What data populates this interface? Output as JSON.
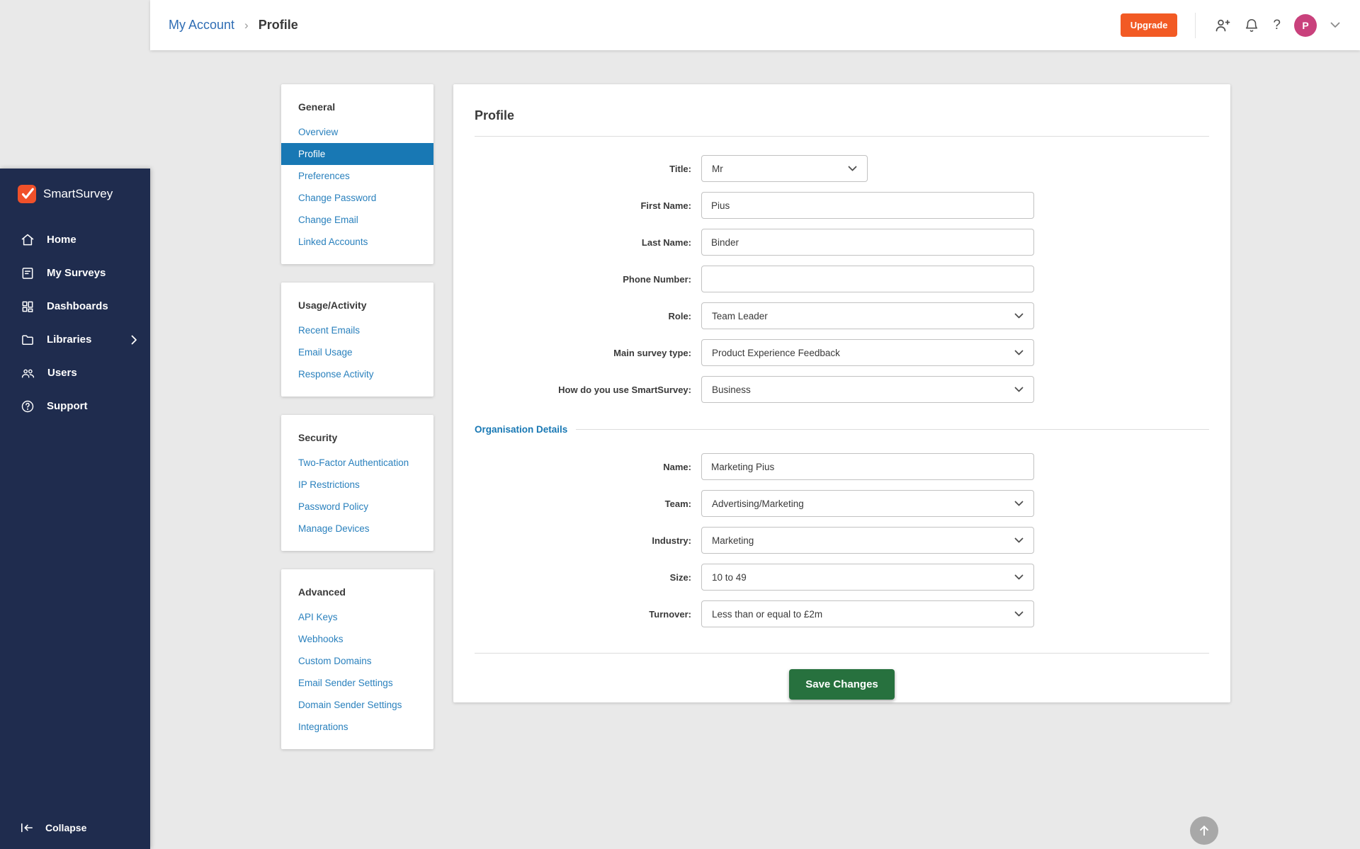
{
  "header": {
    "breadcrumb": {
      "parent": "My Account",
      "separator": "›",
      "current": "Profile"
    },
    "upgrade_label": "Upgrade",
    "help_glyph": "?",
    "avatar_initial": "P"
  },
  "sidebar": {
    "brand": "SmartSurvey",
    "items": [
      {
        "label": "Home",
        "icon": "home-icon"
      },
      {
        "label": "My Surveys",
        "icon": "surveys-icon"
      },
      {
        "label": "Dashboards",
        "icon": "dashboards-icon"
      },
      {
        "label": "Libraries",
        "icon": "folder-icon",
        "has_submenu": true
      },
      {
        "label": "Users",
        "icon": "users-icon"
      },
      {
        "label": "Support",
        "icon": "support-icon"
      }
    ],
    "collapse_label": "Collapse"
  },
  "settings_nav": {
    "sections": [
      {
        "title": "General",
        "links": [
          "Overview",
          "Profile",
          "Preferences",
          "Change Password",
          "Change Email",
          "Linked Accounts"
        ],
        "active": "Profile"
      },
      {
        "title": "Usage/Activity",
        "links": [
          "Recent Emails",
          "Email Usage",
          "Response Activity"
        ]
      },
      {
        "title": "Security",
        "links": [
          "Two-Factor Authentication",
          "IP Restrictions",
          "Password Policy",
          "Manage Devices"
        ]
      },
      {
        "title": "Advanced",
        "links": [
          "API Keys",
          "Webhooks",
          "Custom Domains",
          "Email Sender Settings",
          "Domain Sender Settings",
          "Integrations"
        ]
      }
    ]
  },
  "main": {
    "title": "Profile",
    "fields": [
      {
        "label": "Title:",
        "type": "select",
        "value": "Mr"
      },
      {
        "label": "First Name:",
        "type": "input",
        "value": "Pius"
      },
      {
        "label": "Last Name:",
        "type": "input",
        "value": "Binder"
      },
      {
        "label": "Phone Number:",
        "type": "input",
        "value": ""
      },
      {
        "label": "Role:",
        "type": "select",
        "value": "Team Leader"
      },
      {
        "label": "Main survey type:",
        "type": "select",
        "value": "Product Experience Feedback"
      },
      {
        "label": "How do you use SmartSurvey:",
        "type": "select",
        "value": "Business"
      },
      {
        "label": "Name:",
        "type": "input",
        "value": "Marketing Pius"
      },
      {
        "label": "Team:",
        "type": "select",
        "value": "Advertising/Marketing"
      },
      {
        "label": "Industry:",
        "type": "select",
        "value": "Marketing"
      },
      {
        "label": "Size:",
        "type": "select",
        "value": "10 to 49"
      },
      {
        "label": "Turnover:",
        "type": "select",
        "value": "Less than or equal to £2m"
      }
    ],
    "section_heading": "Organisation Details",
    "save_label": "Save Changes"
  },
  "colors": {
    "sidebar_navy": "#1f2c4e",
    "brand_orange": "#f0512a",
    "upgrade_orange": "#f25a24",
    "link_blue": "#2980bd",
    "active_blue": "#1878b4",
    "breadcrumb_blue": "#2f6db4",
    "save_green": "#27713e",
    "avatar_pink": "#c9417c",
    "page_background": "#e9e9e9"
  }
}
